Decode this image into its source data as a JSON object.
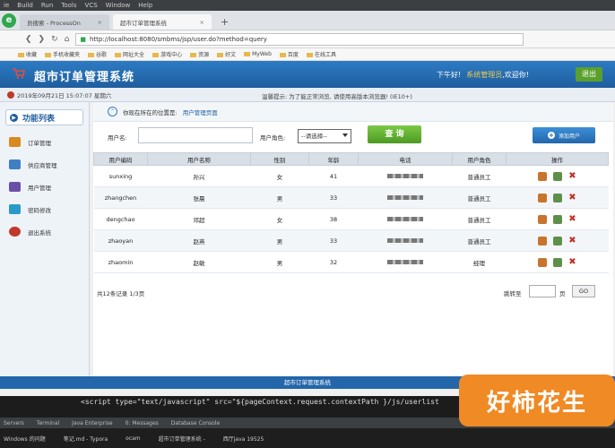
{
  "ide_menu": [
    "ie",
    "Build",
    "Run",
    "Tools",
    "VCS",
    "Window",
    "Help"
  ],
  "browser": {
    "tabs": [
      {
        "title": "员搜索 - ProcessOn",
        "active": false
      },
      {
        "title": "超市订单管理系统",
        "active": true
      }
    ],
    "new_tab": "+",
    "url": "http://localhost:8080/smbms/jsp/user.do?method=query",
    "bookmarks": [
      "收藏",
      "手机收藏夹",
      "谷歌",
      "网址大全",
      "游戏中心",
      "资源",
      "好文",
      "MyWeb",
      "百度",
      "在线工具"
    ]
  },
  "app": {
    "title": "超市订单管理系统",
    "greeting": "下午好!",
    "username": "系统管理员",
    "welcome": ",欢迎你!",
    "logout": "退出",
    "datetime": "2019年09月21日 15:07:07 星期六",
    "tip": "温馨提示: 为了能正常浏览, 请使用高版本浏览器! (IE10+)"
  },
  "sidebar": {
    "title": "功能列表",
    "items": [
      {
        "label": "订单管理",
        "color": "#d88a1e"
      },
      {
        "label": "供应商管理",
        "color": "#3f7fc4"
      },
      {
        "label": "用户管理",
        "color": "#6a4fa8"
      },
      {
        "label": "密码修改",
        "color": "#2a9ac8"
      },
      {
        "label": "退出系统",
        "color": "#c0392b"
      }
    ]
  },
  "main": {
    "location_prefix": "你现在所在的位置是:",
    "location_page": "用户管理页面",
    "search": {
      "username_label": "用户名:",
      "username_value": "",
      "role_label": "用户角色:",
      "role_selected": "--请选择--",
      "query_button": "查 询",
      "add_button": "添加用户"
    },
    "table": {
      "headers": [
        "用户编码",
        "用户名称",
        "性别",
        "年龄",
        "电话",
        "用户角色",
        "操作"
      ],
      "rows": [
        {
          "code": "sunxing",
          "name": "孙兴",
          "gender": "女",
          "age": "41",
          "role": "普通员工"
        },
        {
          "code": "zhangchen",
          "name": "张晨",
          "gender": "男",
          "age": "33",
          "role": "普通员工"
        },
        {
          "code": "dengchao",
          "name": "邓超",
          "gender": "女",
          "age": "38",
          "role": "普通员工"
        },
        {
          "code": "zhaoyan",
          "name": "赵燕",
          "gender": "男",
          "age": "33",
          "role": "普通员工"
        },
        {
          "code": "zhaomin",
          "name": "赵敏",
          "gender": "男",
          "age": "32",
          "role": "经理"
        }
      ]
    },
    "pager": {
      "count": "共12条记录   1/3页",
      "jump_label": "跳转至",
      "page_unit": "页",
      "go": "GO"
    }
  },
  "footer": "超市订单管理系统",
  "code_line": "<script type=\"text/javascript\" src=\"${pageContext.request.contextPath }/js/userlist",
  "ide_bottom": [
    "Servers",
    "Terminal",
    "Java Enterprise",
    "0: Messages",
    "Database Console"
  ],
  "taskbar": [
    "Windows 的问题",
    "笔记.md - Typora",
    "ocam",
    "超市订单管理系统 -",
    "西厅java 19525"
  ],
  "watermark": "好柿花生"
}
